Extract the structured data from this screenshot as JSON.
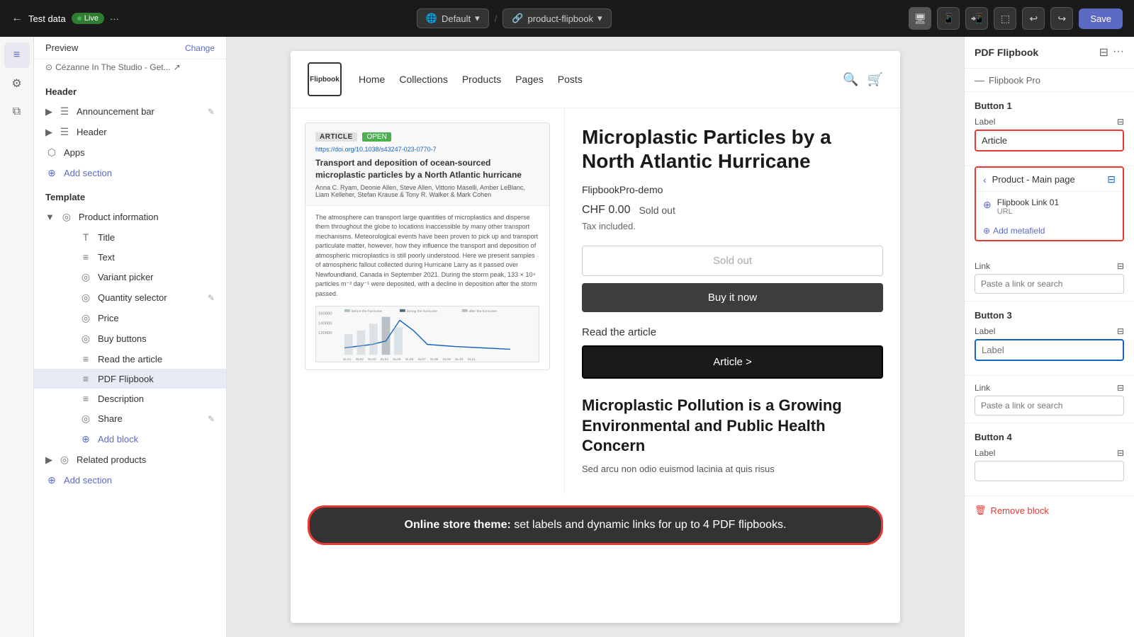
{
  "topbar": {
    "back_icon": "←",
    "title": "Test data",
    "live_label": "Live",
    "more_icon": "···",
    "default_label": "Default",
    "default_icon": "▾",
    "product_label": "product-flipbook",
    "product_icon": "▾",
    "undo_icon": "↩",
    "redo_icon": "↪",
    "save_label": "Save",
    "icons": [
      "🖥",
      "📱",
      "📲",
      "⬚"
    ]
  },
  "sidebar": {
    "preview": {
      "label": "Preview",
      "link": "Change",
      "sub": "Cézanne In The Studio - Get...",
      "sub_icon": "⊙",
      "ext_icon": "↗"
    },
    "header_section": "Header",
    "header_items": [
      {
        "label": "Announcement bar",
        "icon": "☰",
        "edit": true
      },
      {
        "label": "Header",
        "icon": "☰",
        "edit": true
      }
    ],
    "apps_label": "Apps",
    "add_section_label": "Add section",
    "add_section_icon": "⊕",
    "template_label": "Template",
    "product_info_label": "Product information",
    "product_info_icon": "◎",
    "product_info_items": [
      {
        "label": "Title",
        "icon": "T",
        "edit": false
      },
      {
        "label": "Text",
        "icon": "≡",
        "edit": false
      },
      {
        "label": "Variant picker",
        "icon": "◎",
        "edit": false
      },
      {
        "label": "Quantity selector",
        "icon": "◎",
        "edit": true
      },
      {
        "label": "Price",
        "icon": "◎",
        "edit": false
      },
      {
        "label": "Buy buttons",
        "icon": "◎",
        "edit": false
      },
      {
        "label": "Read the article",
        "icon": "≡",
        "edit": false
      },
      {
        "label": "PDF Flipbook",
        "icon": "≡",
        "edit": false,
        "selected": true
      },
      {
        "label": "Description",
        "icon": "≡",
        "edit": false
      },
      {
        "label": "Share",
        "icon": "◎",
        "edit": true
      }
    ],
    "add_block_label": "Add block",
    "add_block_icon": "⊕",
    "related_products_label": "Related products",
    "related_products_icon": "◎",
    "add_section2_label": "Add section",
    "add_section2_icon": "⊕"
  },
  "store": {
    "logo": "Flipbook",
    "nav": [
      "Home",
      "Collections",
      "Products",
      "Pages",
      "Posts"
    ],
    "product_title": "Microplastic Particles by a North Atlantic Hurricane",
    "demo_label": "FlipbookPro-demo",
    "price": "CHF 0.00",
    "sold_out_inline": "Sold out",
    "tax_label": "Tax included.",
    "btn_sold_out": "Sold out",
    "btn_buy": "Buy it now",
    "read_article_label": "Read the article",
    "btn_article": "Article  >",
    "desc_title": "Microplastic Pollution is a Growing Environmental and Public Health Concern",
    "desc_body": "Sed arcu non odio euismod lacinia at quis risus",
    "article": {
      "tag": "ARTICLE",
      "open": "OPEN",
      "url": "https://doi.org/10.1038/s43247-023-0770-7",
      "title": "Transport and deposition of ocean-sourced microplastic particles by a North Atlantic hurricane",
      "authors": "Anna C. Ryam, Deonie Allen, Steve Allen, Vittorio Maselli, Amber LeBlanc, Liam Kelleher, Stefan Krause & Tony R. Walker & Mark Cohen"
    },
    "banner": {
      "bold": "Online store theme:",
      "normal": " set labels and dynamic links for up to 4 PDF flipbooks."
    }
  },
  "right_panel": {
    "title": "PDF Flipbook",
    "copy_icon": "⊟",
    "more_icon": "···",
    "subtitle": "Flipbook Pro",
    "sub_icon": "—",
    "button1": {
      "section_title": "Button 1",
      "label_field": "Label",
      "label_db_icon": "⊟",
      "label_value": "Article",
      "dropdown_title": "Product - Main page",
      "back_icon": "‹",
      "db_icon": "⊟",
      "item_icon": "⊕",
      "item_title": "Flipbook Link 01",
      "item_sub": "URL",
      "add_meta": "Add metafield"
    },
    "link_section": {
      "label": "Link",
      "db_icon": "⊟",
      "placeholder": "Paste a link or search"
    },
    "button3": {
      "section_title": "Button 3",
      "label_field": "Label",
      "db_icon": "⊟",
      "label_value": "",
      "link_label": "Link",
      "link_db_icon": "⊟",
      "link_placeholder": "Paste a link or search"
    },
    "button4": {
      "section_title": "Button 4",
      "label_field": "Label",
      "db_icon": "⊟",
      "label_value": ""
    },
    "remove_label": "Remove block",
    "remove_icon": "🗑"
  }
}
